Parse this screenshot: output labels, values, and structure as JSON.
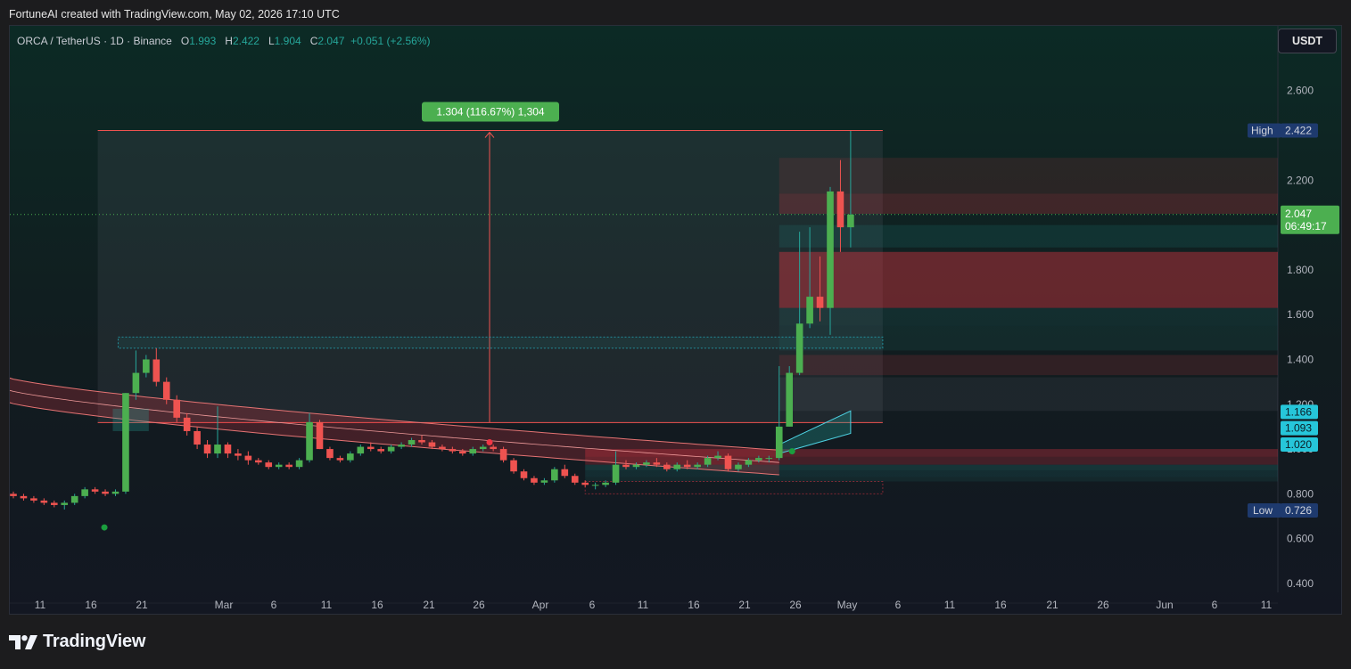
{
  "header": {
    "credit": "FortuneAI created with TradingView.com, May 02, 2026 17:10 UTC"
  },
  "legend": {
    "symbol": "ORCA / TetherUS · 1D · Binance",
    "open_label": "O",
    "open": "1.993",
    "high_label": "H",
    "high": "2.422",
    "low_label": "L",
    "low": "1.904",
    "close_label": "C",
    "close": "2.047",
    "change": "+0.051 (+2.56%)"
  },
  "currency_button": "USDT",
  "footer": {
    "brand": "TradingView"
  },
  "colors": {
    "up": "#26a69a",
    "up_bright": "#4caf50",
    "down": "#ef5350",
    "background": "#131722",
    "axis_text": "#b2b5be",
    "price_label": "#4caf50",
    "cyan_label": "#26c6da",
    "high_low_label": "#1e3a6e"
  },
  "chart_data": {
    "type": "candlestick",
    "x_ticks": [
      "11",
      "16",
      "21",
      "Mar",
      "6",
      "11",
      "16",
      "21",
      "26",
      "Apr",
      "6",
      "11",
      "16",
      "21",
      "26",
      "May",
      "6",
      "11",
      "16",
      "21",
      "26",
      "Jun",
      "6",
      "11"
    ],
    "y_ticks": [
      "2.600",
      "2.200",
      "1.800",
      "1.600",
      "1.400",
      "1.200",
      "1.000",
      "0.800",
      "0.600",
      "0.400"
    ],
    "y_range": [
      0.36,
      2.77
    ],
    "last_price": "2.047",
    "countdown": "06:49:17",
    "high_label": "High",
    "high_value": "2.422",
    "low_label": "Low",
    "low_value": "0.726",
    "levels": [
      "1.166",
      "1.093",
      "1.020"
    ],
    "measure_label": "1.304 (116.67%) 1,304",
    "candles": [
      [
        0.8,
        0.81,
        0.78,
        0.79
      ],
      [
        0.79,
        0.8,
        0.77,
        0.78
      ],
      [
        0.78,
        0.79,
        0.76,
        0.77
      ],
      [
        0.77,
        0.78,
        0.75,
        0.76
      ],
      [
        0.76,
        0.77,
        0.74,
        0.75
      ],
      [
        0.75,
        0.77,
        0.73,
        0.76
      ],
      [
        0.76,
        0.8,
        0.75,
        0.79
      ],
      [
        0.79,
        0.83,
        0.78,
        0.82
      ],
      [
        0.82,
        0.83,
        0.8,
        0.81
      ],
      [
        0.81,
        0.82,
        0.79,
        0.8
      ],
      [
        0.8,
        0.82,
        0.79,
        0.81
      ],
      [
        0.81,
        1.25,
        0.8,
        1.25
      ],
      [
        1.25,
        1.44,
        1.22,
        1.34
      ],
      [
        1.34,
        1.42,
        1.32,
        1.4
      ],
      [
        1.4,
        1.45,
        1.28,
        1.3
      ],
      [
        1.3,
        1.32,
        1.2,
        1.22
      ],
      [
        1.22,
        1.24,
        1.12,
        1.14
      ],
      [
        1.14,
        1.16,
        1.06,
        1.08
      ],
      [
        1.08,
        1.1,
        1.0,
        1.02
      ],
      [
        1.02,
        1.04,
        0.96,
        0.98
      ],
      [
        0.98,
        1.19,
        0.96,
        1.02
      ],
      [
        1.02,
        1.03,
        0.96,
        0.98
      ],
      [
        0.98,
        1.0,
        0.95,
        0.97
      ],
      [
        0.97,
        0.99,
        0.93,
        0.95
      ],
      [
        0.95,
        0.96,
        0.93,
        0.94
      ],
      [
        0.94,
        0.95,
        0.91,
        0.92
      ],
      [
        0.92,
        0.94,
        0.91,
        0.93
      ],
      [
        0.93,
        0.94,
        0.91,
        0.92
      ],
      [
        0.92,
        0.96,
        0.91,
        0.95
      ],
      [
        0.95,
        1.16,
        0.94,
        1.12
      ],
      [
        1.12,
        1.13,
        1.0,
        1.0
      ],
      [
        1.0,
        1.01,
        0.95,
        0.96
      ],
      [
        0.96,
        0.97,
        0.94,
        0.95
      ],
      [
        0.95,
        0.99,
        0.94,
        0.98
      ],
      [
        0.98,
        1.02,
        0.97,
        1.01
      ],
      [
        1.01,
        1.03,
        0.99,
        1.0
      ],
      [
        1.0,
        1.01,
        0.98,
        0.99
      ],
      [
        0.99,
        1.02,
        0.98,
        1.01
      ],
      [
        1.01,
        1.03,
        1.0,
        1.02
      ],
      [
        1.02,
        1.05,
        1.01,
        1.04
      ],
      [
        1.04,
        1.06,
        1.02,
        1.03
      ],
      [
        1.03,
        1.04,
        1.0,
        1.01
      ],
      [
        1.01,
        1.02,
        0.99,
        1.0
      ],
      [
        1.0,
        1.01,
        0.98,
        0.99
      ],
      [
        0.99,
        1.0,
        0.97,
        0.98
      ],
      [
        0.98,
        1.01,
        0.97,
        1.0
      ],
      [
        1.0,
        1.02,
        0.99,
        1.01
      ],
      [
        1.01,
        1.02,
        0.99,
        1.0
      ],
      [
        1.0,
        1.01,
        0.94,
        0.95
      ],
      [
        0.95,
        0.96,
        0.89,
        0.9
      ],
      [
        0.9,
        0.91,
        0.86,
        0.87
      ],
      [
        0.87,
        0.88,
        0.84,
        0.85
      ],
      [
        0.85,
        0.87,
        0.84,
        0.86
      ],
      [
        0.86,
        0.92,
        0.85,
        0.91
      ],
      [
        0.91,
        0.93,
        0.87,
        0.88
      ],
      [
        0.88,
        0.89,
        0.84,
        0.85
      ],
      [
        0.85,
        0.86,
        0.83,
        0.84
      ],
      [
        0.84,
        0.85,
        0.82,
        0.84
      ],
      [
        0.84,
        0.86,
        0.83,
        0.85
      ],
      [
        0.85,
        0.99,
        0.84,
        0.93
      ],
      [
        0.93,
        0.95,
        0.91,
        0.92
      ],
      [
        0.92,
        0.94,
        0.91,
        0.93
      ],
      [
        0.93,
        0.95,
        0.92,
        0.94
      ],
      [
        0.94,
        0.96,
        0.92,
        0.93
      ],
      [
        0.93,
        0.94,
        0.9,
        0.91
      ],
      [
        0.91,
        0.94,
        0.9,
        0.93
      ],
      [
        0.93,
        0.95,
        0.91,
        0.92
      ],
      [
        0.92,
        0.94,
        0.91,
        0.93
      ],
      [
        0.93,
        0.97,
        0.92,
        0.96
      ],
      [
        0.96,
        0.99,
        0.95,
        0.97
      ],
      [
        0.97,
        0.98,
        0.9,
        0.91
      ],
      [
        0.91,
        0.94,
        0.9,
        0.93
      ],
      [
        0.93,
        0.96,
        0.92,
        0.95
      ],
      [
        0.95,
        0.97,
        0.94,
        0.96
      ],
      [
        0.96,
        0.97,
        0.94,
        0.96
      ],
      [
        0.96,
        1.37,
        0.95,
        1.1
      ],
      [
        1.1,
        1.37,
        1.1,
        1.34
      ],
      [
        1.34,
        1.97,
        1.33,
        1.56
      ],
      [
        1.56,
        1.99,
        1.54,
        1.68
      ],
      [
        1.68,
        1.86,
        1.57,
        1.63
      ],
      [
        1.63,
        2.17,
        1.51,
        2.15
      ],
      [
        2.15,
        2.29,
        1.88,
        1.99
      ],
      [
        1.99,
        2.42,
        1.9,
        2.047
      ]
    ]
  }
}
